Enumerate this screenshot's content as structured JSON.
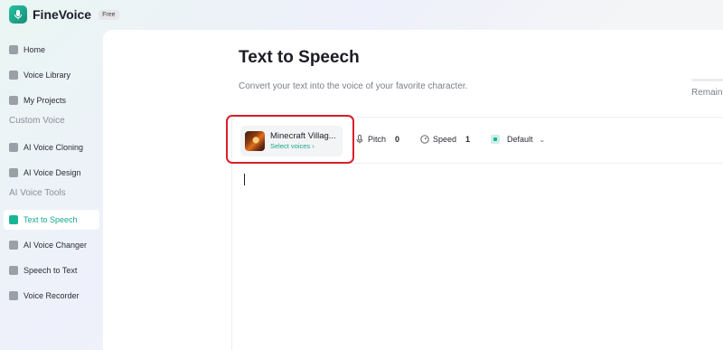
{
  "brand": {
    "name": "FineVoice",
    "badge": "Free"
  },
  "sidebar": {
    "items": [
      {
        "label": "Home",
        "icon": "home-icon"
      },
      {
        "label": "Voice Library",
        "icon": "library-icon"
      },
      {
        "label": "My Projects",
        "icon": "folder-icon"
      }
    ],
    "section_custom": "Custom Voice",
    "custom_items": [
      {
        "label": "AI Voice Cloning",
        "icon": "clone-icon"
      },
      {
        "label": "AI Voice Design",
        "icon": "design-icon"
      }
    ],
    "section_tools": "AI Voice Tools",
    "tool_items": [
      {
        "label": "Text to Speech",
        "icon": "tts-icon",
        "active": true
      },
      {
        "label": "AI Voice Changer",
        "icon": "mic-icon"
      },
      {
        "label": "Speech to Text",
        "icon": "stt-icon"
      },
      {
        "label": "Voice Recorder",
        "icon": "record-icon"
      }
    ],
    "active_color": "#18a88c"
  },
  "main": {
    "title": "Text to Speech",
    "subtitle": "Convert your text into the voice of your favorite character.",
    "remaining_label": "Remain"
  },
  "toolbar": {
    "voice_name": "Minecraft Villag...",
    "select_voices": "Select voices ›",
    "pitch_label": "Pitch",
    "pitch_value": "0",
    "speed_label": "Speed",
    "speed_value": "1",
    "emotion_value": "Default"
  },
  "colors": {
    "accent": "#19b597",
    "highlight": "#d8202a"
  }
}
